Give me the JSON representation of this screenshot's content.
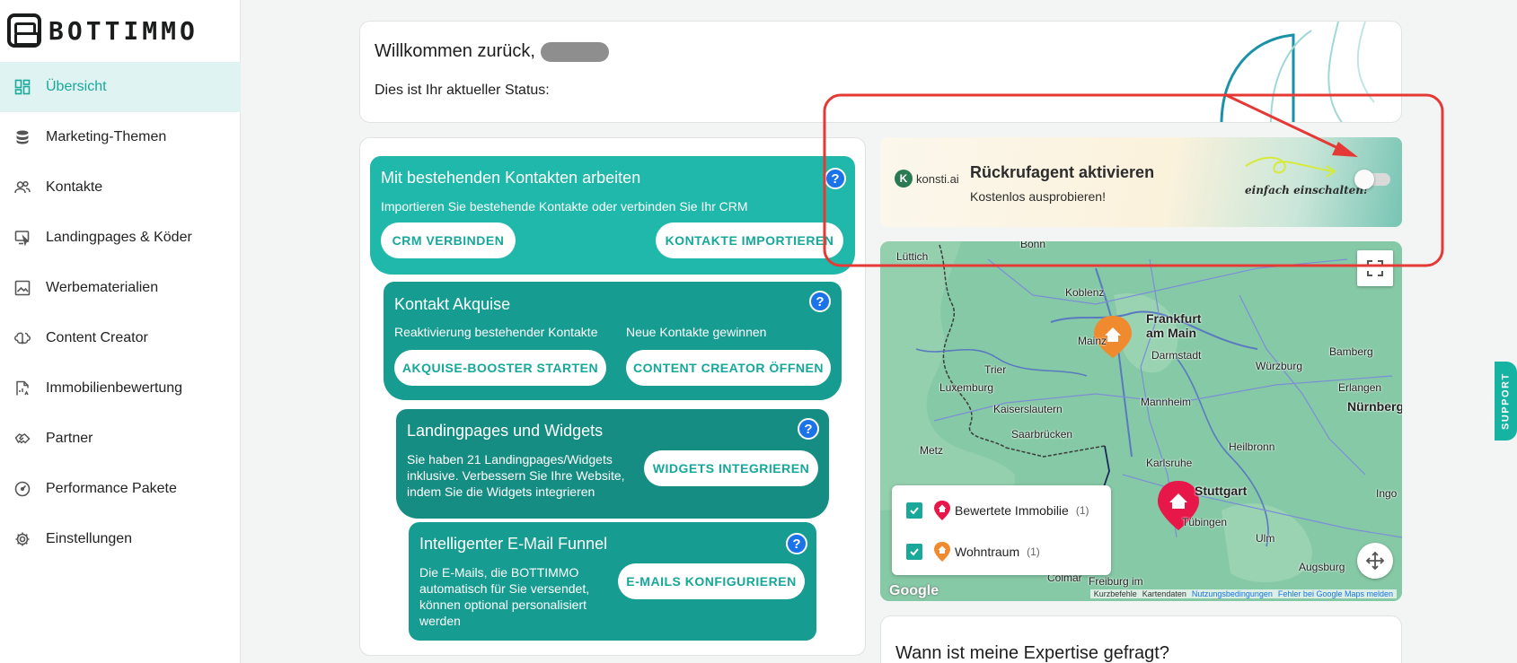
{
  "brand": {
    "name": "BOTTIMMO"
  },
  "sidebar": {
    "items": [
      {
        "label": "Übersicht",
        "icon": "dashboard-icon",
        "active": true
      },
      {
        "label": "Marketing-Themen",
        "icon": "database-icon"
      },
      {
        "label": "Kontakte",
        "icon": "people-icon"
      },
      {
        "label": "Landingpages & Köder",
        "icon": "landingpage-icon"
      },
      {
        "label": "Werbematerialien",
        "icon": "image-icon"
      },
      {
        "label": "Content Creator",
        "icon": "brain-icon"
      },
      {
        "label": "Immobilienbewertung",
        "icon": "valuation-icon"
      },
      {
        "label": "Partner",
        "icon": "handshake-icon"
      },
      {
        "label": "Performance Pakete",
        "icon": "gauge-icon"
      },
      {
        "label": "Einstellungen",
        "icon": "gear-icon"
      }
    ]
  },
  "welcome": {
    "title": "Willkommen zurück,",
    "subtitle": "Dies ist Ihr aktueller Status:"
  },
  "funnel": {
    "stage1": {
      "title": "Mit bestehenden Kontakten arbeiten",
      "text": "Importieren Sie bestehende Kontakte oder verbinden Sie Ihr CRM",
      "btn_left": "CRM VERBINDEN",
      "btn_right": "KONTAKTE IMPORTIEREN"
    },
    "stage2": {
      "title": "Kontakt Akquise",
      "text_left": "Reaktivierung bestehender Kontakte",
      "text_right": "Neue Kontakte gewinnen",
      "btn_left": "AKQUISE-BOOSTER STARTEN",
      "btn_right": "CONTENT CREATOR ÖFFNEN"
    },
    "stage3": {
      "title": "Landingpages und Widgets",
      "text": "Sie haben 21 Landingpages/Widgets inklusive. Verbessern Sie Ihre Website, indem Sie die Widgets integrieren",
      "btn": "WIDGETS INTEGRIEREN"
    },
    "stage4": {
      "title": "Intelligenter E-Mail Funnel",
      "text": "Die E-Mails, die BOTTIMMO automatisch für Sie versendet, können optional personalisiert werden",
      "btn": "E-MAILS KONFIGURIEREN"
    },
    "help_label": "?"
  },
  "konsti": {
    "logo": "konsti.ai",
    "logo_letter": "K",
    "title": "Rückrufagent aktivieren",
    "subtitle": "Kostenlos ausprobieren!",
    "hint": "einfach einschalten!",
    "toggle_on": false
  },
  "map": {
    "cities": [
      {
        "name": "Bonn",
        "big": false
      },
      {
        "name": "Lüttich",
        "big": false
      },
      {
        "name": "Koblenz",
        "big": false
      },
      {
        "name": "Frankfurt am Main",
        "big": true
      },
      {
        "name": "Mainz",
        "big": false
      },
      {
        "name": "Darmstadt",
        "big": false
      },
      {
        "name": "Trier",
        "big": false
      },
      {
        "name": "Luxemburg",
        "big": false
      },
      {
        "name": "Würzburg",
        "big": false
      },
      {
        "name": "Bamberg",
        "big": false
      },
      {
        "name": "Erlangen",
        "big": false
      },
      {
        "name": "Nürnberg",
        "big": true
      },
      {
        "name": "Mannheim",
        "big": false
      },
      {
        "name": "Kaiserslautern",
        "big": false
      },
      {
        "name": "Saarbrücken",
        "big": false
      },
      {
        "name": "Heilbronn",
        "big": false
      },
      {
        "name": "Metz",
        "big": false
      },
      {
        "name": "Karlsruhe",
        "big": false
      },
      {
        "name": "Stuttgart",
        "big": true
      },
      {
        "name": "Tübingen",
        "big": false
      },
      {
        "name": "Ulm",
        "big": false
      },
      {
        "name": "Augsburg",
        "big": false
      },
      {
        "name": "Ingo",
        "big": false
      },
      {
        "name": "Freiburg im",
        "big": false
      },
      {
        "name": "Colmar",
        "big": false
      }
    ],
    "legend": [
      {
        "label": "Bewertete Immobilie",
        "count": "(1)",
        "color": "#e8174a"
      },
      {
        "label": "Wohntraum",
        "count": "(1)",
        "color": "#f08a2e"
      }
    ],
    "google": "Google",
    "attribution": {
      "shortcuts": "Kurzbefehle",
      "mapdata": "Kartendaten",
      "terms": "Nutzungsbedingungen",
      "report": "Fehler bei Google Maps melden"
    }
  },
  "expertise": {
    "title": "Wann ist meine Expertise gefragt?"
  },
  "support": {
    "label": "SUPPORT"
  },
  "colors": {
    "accent": "#1aa89b",
    "stage1": "#1fb8aa",
    "stage2": "#169c90",
    "stage3": "#168d83",
    "annotation": "#e53935",
    "help": "#1a73e8"
  }
}
